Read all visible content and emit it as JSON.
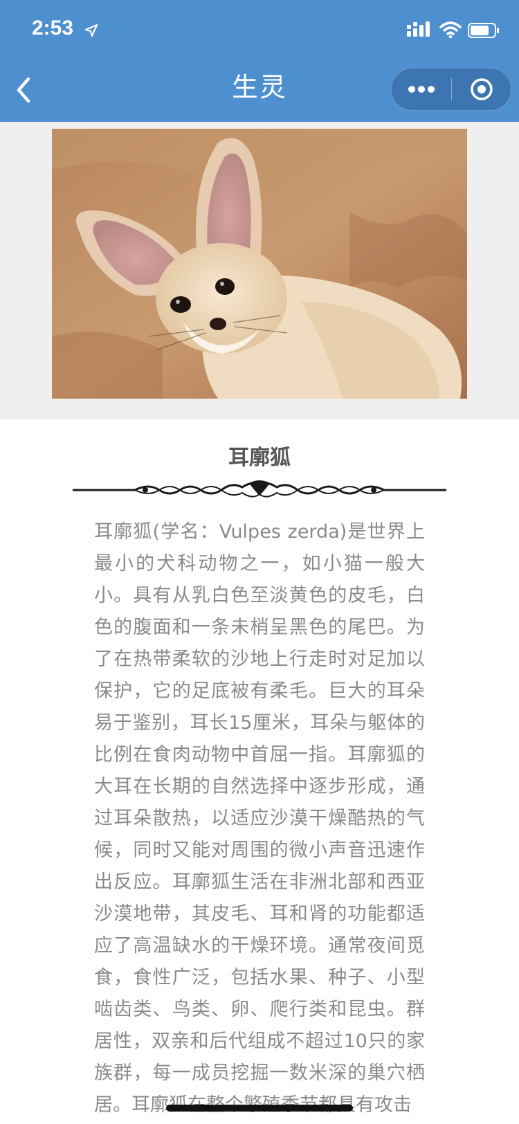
{
  "status_bar": {
    "time": "2:53"
  },
  "nav": {
    "title": "生灵",
    "back_icon": "chevron-left-icon",
    "more_icon": "more-dots-icon",
    "close_icon": "target-circle-icon"
  },
  "colors": {
    "nav_bg": "#4e8fd0",
    "page_bg": "#ffffff",
    "image_bg": "#efefef",
    "body_text": "#8a8a8a",
    "title_text": "#555555"
  },
  "article": {
    "image_alt": "fennec fox photo",
    "title": "耳廓狐",
    "body": "耳廓狐(学名：Vulpes zerda)是世界上最小的犬科动物之一，如小猫一般大小。具有从乳白色至淡黄色的皮毛，白色的腹面和一条未梢呈黑色的尾巴。为了在热带柔软的沙地上行走时对足加以保护，它的足底被有柔毛。巨大的耳朵易于鉴别，耳长15厘米，耳朵与躯体的比例在食肉动物中首屈一指。耳廓狐的大耳在长期的自然选择中逐步形成，通过耳朵散热，以适应沙漠干燥酷热的气候，同时又能对周围的微小声音迅速作出反应。耳廓狐生活在非洲北部和西亚沙漠地带，其皮毛、耳和肾的功能都适应了高温缺水的干燥环境。通常夜间觅食，食性广泛，包括水果、种子、小型啮齿类、鸟类、卵、爬行类和昆虫。群居性，双亲和后代组成不超过10只的家族群，每一成员挖掘一数米深的巢穴栖居。耳廓狐在整个繁殖季节都具有攻击"
  }
}
